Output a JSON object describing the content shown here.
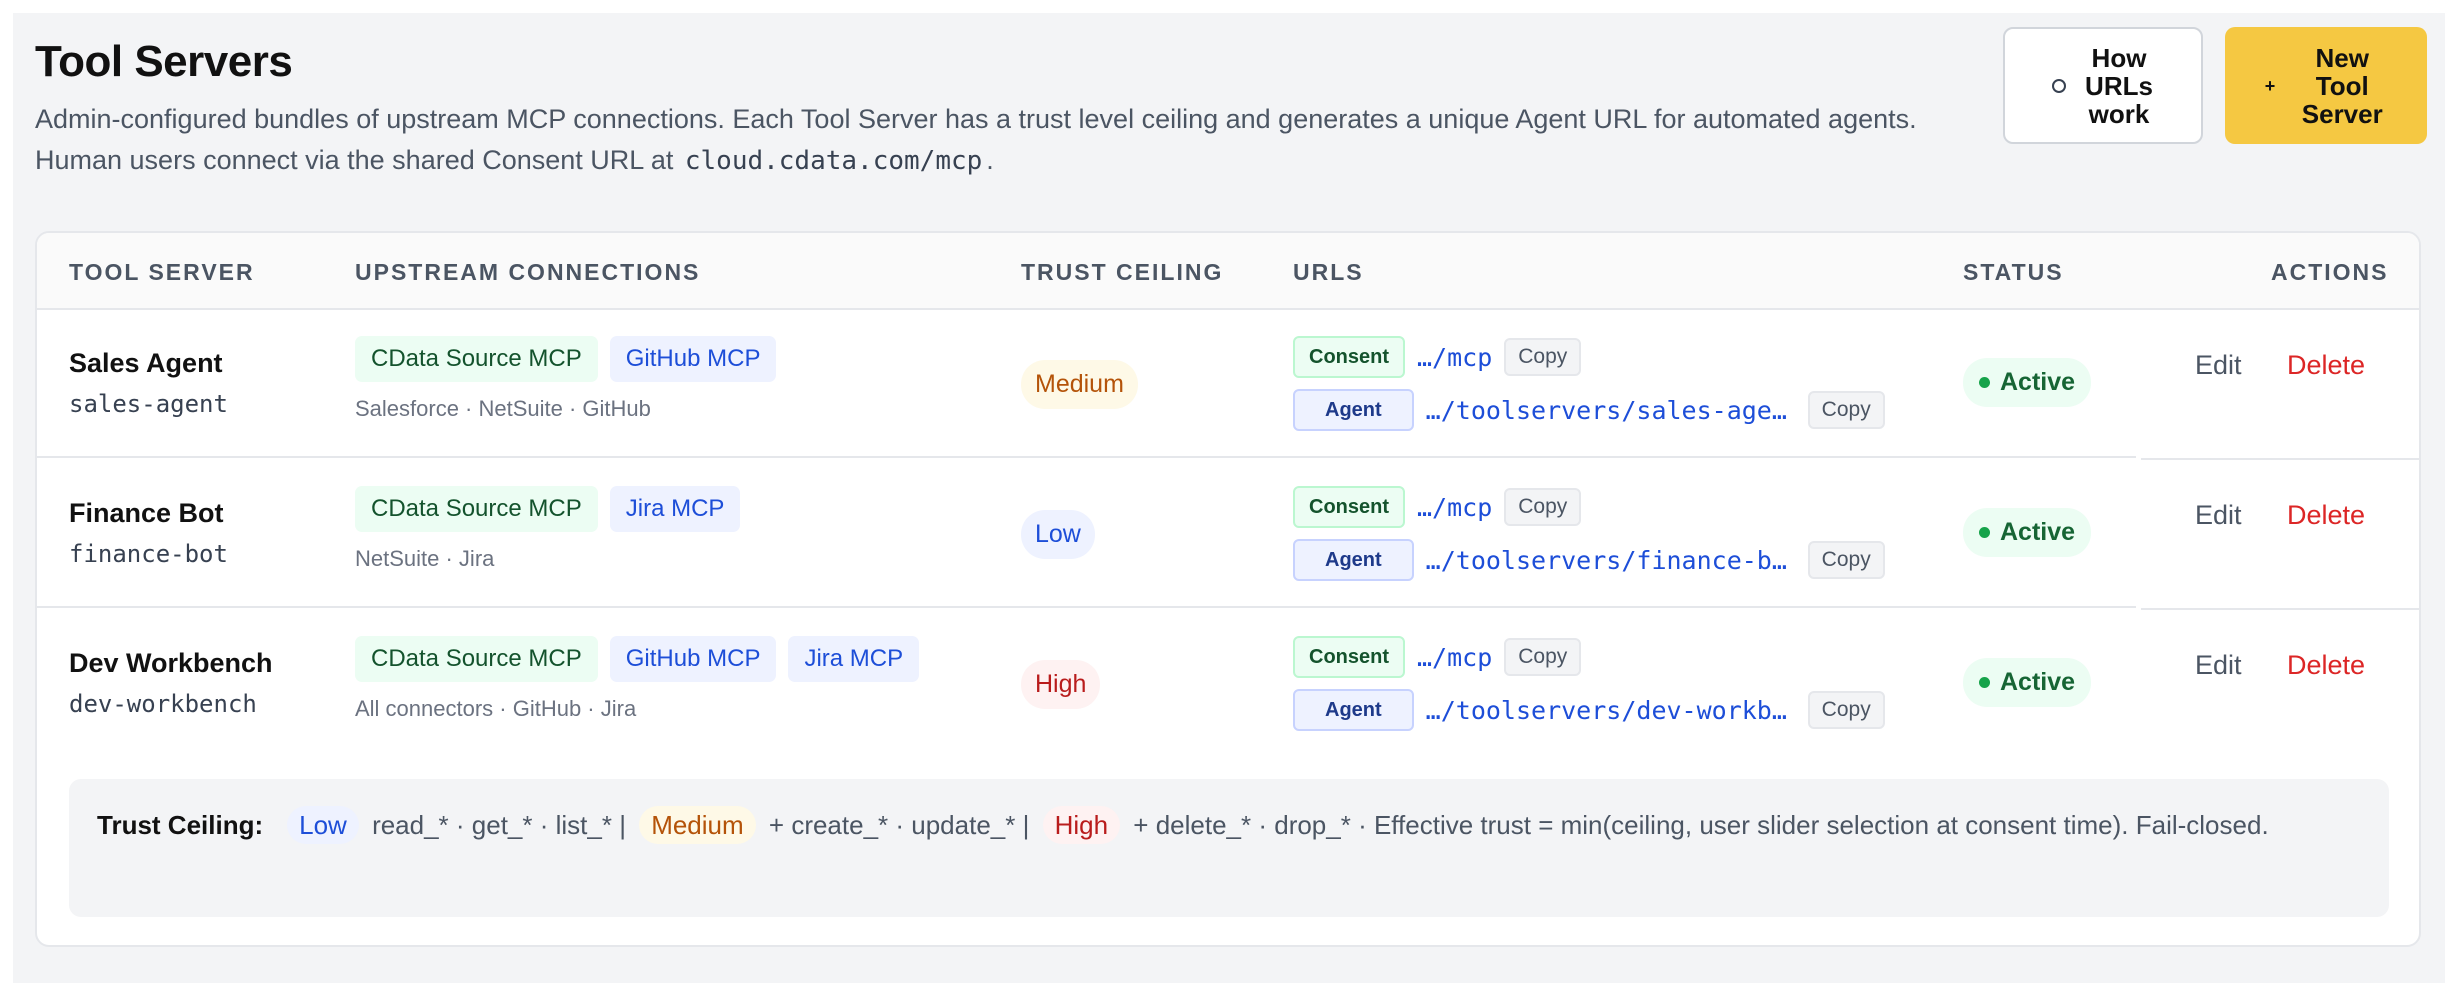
{
  "header": {
    "title": "Tool Servers",
    "subtitle_text": "Admin-configured bundles of upstream MCP connections. Each Tool Server has a trust level ceiling and generates a unique Agent URL for automated agents. Human users connect via the shared Consent URL at",
    "subtitle_code": "cloud.cdata.com/mcp",
    "subtitle_end": ".",
    "how_button": "How URLs work",
    "new_button": "New Tool Server",
    "how_icon": "info-circle-icon",
    "new_icon": "plus-icon"
  },
  "table": {
    "columns": [
      "TOOL SERVER",
      "UPSTREAM CONNECTIONS",
      "TRUST CEILING",
      "URLS",
      "STATUS",
      "ACTIONS"
    ],
    "rows": [
      {
        "name": "Sales Agent",
        "slug": "sales-agent",
        "chips": [
          {
            "label": "CData Source MCP",
            "color": "green"
          },
          {
            "label": "GitHub MCP",
            "color": "blue"
          }
        ],
        "connections": "Salesforce · NetSuite · GitHub",
        "trust": "Medium",
        "consent_tag": "Consent",
        "consent_url": "…/mcp",
        "agent_tag": "Agent",
        "agent_url": "…/toolservers/sales-agent",
        "copy_label": "Copy",
        "status": "Active",
        "edit": "Edit",
        "delete": "Delete"
      },
      {
        "name": "Finance Bot",
        "slug": "finance-bot",
        "chips": [
          {
            "label": "CData Source MCP",
            "color": "green"
          },
          {
            "label": "Jira MCP",
            "color": "blue"
          }
        ],
        "connections": "NetSuite · Jira",
        "trust": "Low",
        "consent_tag": "Consent",
        "consent_url": "…/mcp",
        "agent_tag": "Agent",
        "agent_url": "…/toolservers/finance-bot",
        "copy_label": "Copy",
        "status": "Active",
        "edit": "Edit",
        "delete": "Delete"
      },
      {
        "name": "Dev Workbench",
        "slug": "dev-workbench",
        "chips": [
          {
            "label": "CData Source MCP",
            "color": "green"
          },
          {
            "label": "GitHub MCP",
            "color": "blue"
          },
          {
            "label": "Jira MCP",
            "color": "blue"
          }
        ],
        "connections": "All connectors · GitHub · Jira",
        "trust": "High",
        "consent_tag": "Consent",
        "consent_url": "…/mcp",
        "agent_tag": "Agent",
        "agent_url": "…/toolservers/dev-workbe…",
        "copy_label": "Copy",
        "status": "Active",
        "edit": "Edit",
        "delete": "Delete"
      }
    ]
  },
  "legend": {
    "label": "Trust Ceiling:",
    "low": "Low",
    "low_text": "read_* · get_* · list_*  |",
    "medium": "Medium",
    "medium_text": "+ create_* · update_*  |",
    "high": "High",
    "high_text": "+ delete_* · drop_*  ·  Effective trust = min(ceiling, user slider selection at consent time). Fail-closed."
  },
  "colors": {
    "accent": "#f5c842",
    "link": "#1d4ed8",
    "danger": "#dc2626",
    "success": "#16a34a"
  }
}
